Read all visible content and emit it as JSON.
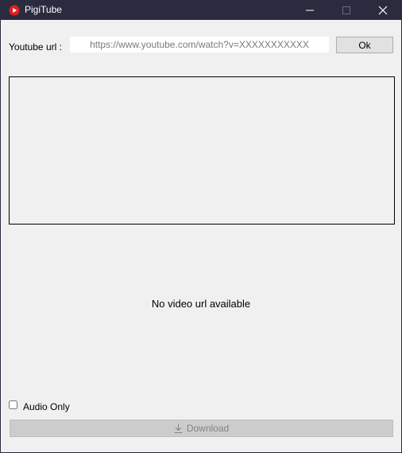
{
  "window": {
    "title": "PigiTube",
    "icon": "youtube-play-icon",
    "controls": [
      "minimize-icon",
      "maximize-icon",
      "close-icon"
    ]
  },
  "url_row": {
    "label": "Youtube url :",
    "input_value": "",
    "input_placeholder": "https://www.youtube.com/watch?v=XXXXXXXXXXX",
    "ok_label": "Ok"
  },
  "preview": {
    "status": "No video url available"
  },
  "options": {
    "audio_only_label": "Audio Only",
    "audio_only_checked": false
  },
  "download": {
    "label": "Download",
    "icon": "download-icon",
    "enabled": false
  },
  "colors": {
    "titlebar": "#2b2b3f",
    "background": "#f0f0f0",
    "app_icon_red": "#e02020"
  }
}
